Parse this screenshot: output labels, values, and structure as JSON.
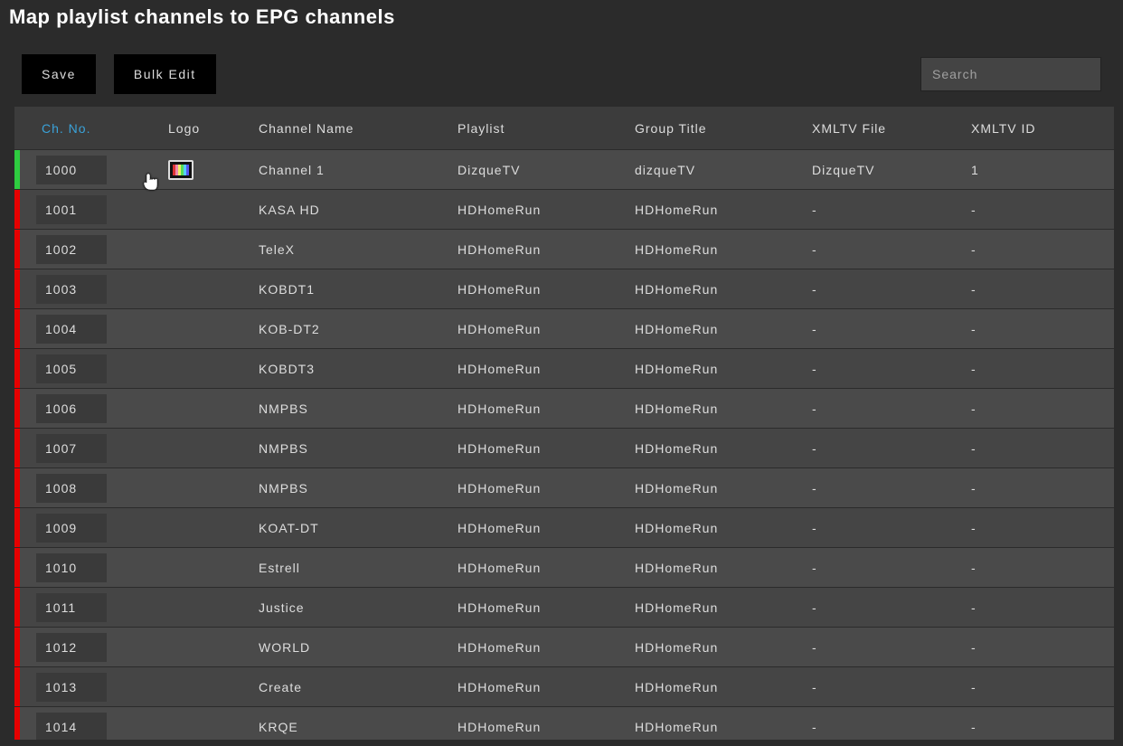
{
  "header": {
    "title": "Map playlist channels to EPG channels"
  },
  "toolbar": {
    "save_label": "Save",
    "bulk_edit_label": "Bulk Edit",
    "search_placeholder": "Search"
  },
  "columns": {
    "ch_no": "Ch. No.",
    "logo": "Logo",
    "channel_name": "Channel Name",
    "playlist": "Playlist",
    "group_title": "Group Title",
    "xmltv_file": "XMLTV File",
    "xmltv_id": "XMLTV ID"
  },
  "rows": [
    {
      "status": "green",
      "ch_no": "1000",
      "has_logo": true,
      "name": "Channel 1",
      "playlist": "DizqueTV",
      "group": "dizqueTV",
      "xmltv_file": "DizqueTV",
      "xmltv_id": "1"
    },
    {
      "status": "red",
      "ch_no": "1001",
      "has_logo": false,
      "name": "KASA HD",
      "playlist": "HDHomeRun",
      "group": "HDHomeRun",
      "xmltv_file": "-",
      "xmltv_id": "-"
    },
    {
      "status": "red",
      "ch_no": "1002",
      "has_logo": false,
      "name": "TeleX",
      "playlist": "HDHomeRun",
      "group": "HDHomeRun",
      "xmltv_file": "-",
      "xmltv_id": "-"
    },
    {
      "status": "red",
      "ch_no": "1003",
      "has_logo": false,
      "name": "KOBDT1",
      "playlist": "HDHomeRun",
      "group": "HDHomeRun",
      "xmltv_file": "-",
      "xmltv_id": "-"
    },
    {
      "status": "red",
      "ch_no": "1004",
      "has_logo": false,
      "name": "KOB-DT2",
      "playlist": "HDHomeRun",
      "group": "HDHomeRun",
      "xmltv_file": "-",
      "xmltv_id": "-"
    },
    {
      "status": "red",
      "ch_no": "1005",
      "has_logo": false,
      "name": "KOBDT3",
      "playlist": "HDHomeRun",
      "group": "HDHomeRun",
      "xmltv_file": "-",
      "xmltv_id": "-"
    },
    {
      "status": "red",
      "ch_no": "1006",
      "has_logo": false,
      "name": "NMPBS",
      "playlist": "HDHomeRun",
      "group": "HDHomeRun",
      "xmltv_file": "-",
      "xmltv_id": "-"
    },
    {
      "status": "red",
      "ch_no": "1007",
      "has_logo": false,
      "name": "NMPBS",
      "playlist": "HDHomeRun",
      "group": "HDHomeRun",
      "xmltv_file": "-",
      "xmltv_id": "-"
    },
    {
      "status": "red",
      "ch_no": "1008",
      "has_logo": false,
      "name": "NMPBS",
      "playlist": "HDHomeRun",
      "group": "HDHomeRun",
      "xmltv_file": "-",
      "xmltv_id": "-"
    },
    {
      "status": "red",
      "ch_no": "1009",
      "has_logo": false,
      "name": "KOAT-DT",
      "playlist": "HDHomeRun",
      "group": "HDHomeRun",
      "xmltv_file": "-",
      "xmltv_id": "-"
    },
    {
      "status": "red",
      "ch_no": "1010",
      "has_logo": false,
      "name": "Estrell",
      "playlist": "HDHomeRun",
      "group": "HDHomeRun",
      "xmltv_file": "-",
      "xmltv_id": "-"
    },
    {
      "status": "red",
      "ch_no": "1011",
      "has_logo": false,
      "name": "Justice",
      "playlist": "HDHomeRun",
      "group": "HDHomeRun",
      "xmltv_file": "-",
      "xmltv_id": "-"
    },
    {
      "status": "red",
      "ch_no": "1012",
      "has_logo": false,
      "name": "WORLD",
      "playlist": "HDHomeRun",
      "group": "HDHomeRun",
      "xmltv_file": "-",
      "xmltv_id": "-"
    },
    {
      "status": "red",
      "ch_no": "1013",
      "has_logo": false,
      "name": "Create",
      "playlist": "HDHomeRun",
      "group": "HDHomeRun",
      "xmltv_file": "-",
      "xmltv_id": "-"
    },
    {
      "status": "red",
      "ch_no": "1014",
      "has_logo": false,
      "name": "KRQE",
      "playlist": "HDHomeRun",
      "group": "HDHomeRun",
      "xmltv_file": "-",
      "xmltv_id": "-"
    }
  ]
}
